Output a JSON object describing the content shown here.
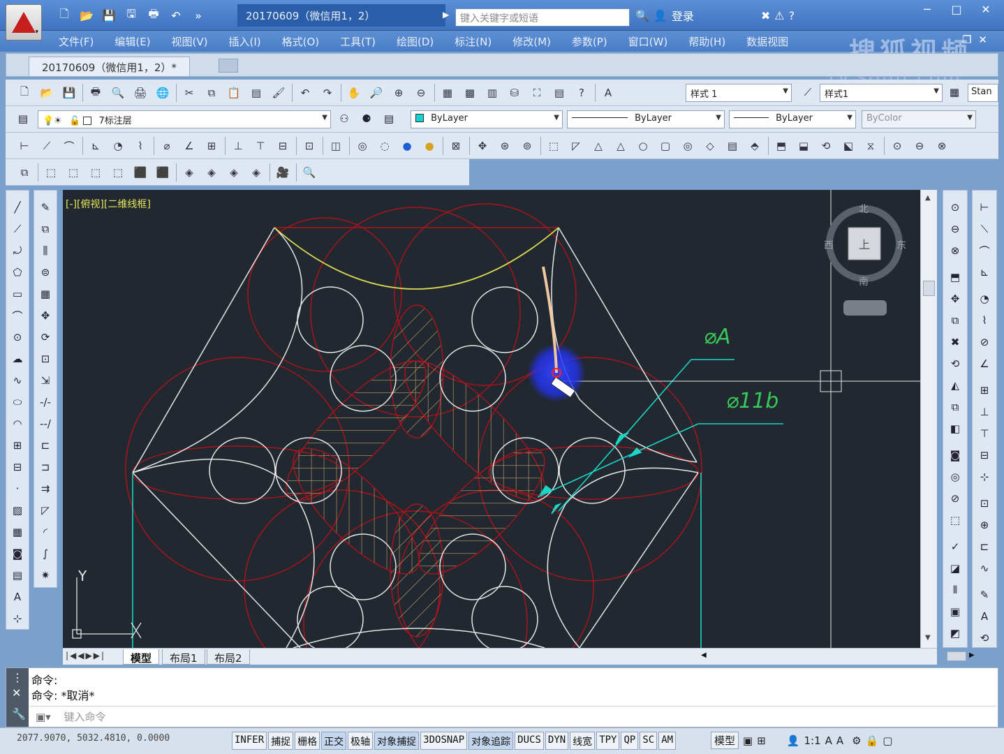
{
  "app": {
    "document_title": "20170609（微信用1，2）",
    "search_placeholder": "键入关键字或短语",
    "login_label": "登录"
  },
  "window_buttons": [
    "─",
    "□",
    "✕"
  ],
  "menu": [
    "文件(F)",
    "编辑(E)",
    "视图(V)",
    "插入(I)",
    "格式(O)",
    "工具(T)",
    "绘图(D)",
    "标注(N)",
    "修改(M)",
    "参数(P)",
    "窗口(W)",
    "帮助(H)",
    "数据视图"
  ],
  "watermark": {
    "main": "搜狐视频",
    "sub": "tv.sohu.com"
  },
  "doc_tab": {
    "label": "20170609（微信用1，2）*"
  },
  "toolbar": {
    "text_style": "样式 1",
    "dim_style": "样式1",
    "table_style": "Stan",
    "layer": "7标注层",
    "color": "ByLayer",
    "linetype": "ByLayer",
    "lineweight": "ByLayer",
    "plotstyle": "ByColor"
  },
  "viewport": {
    "label": "[-][俯视][二维线框]",
    "dim_a": "⌀A",
    "dim_b": "⌀11b",
    "axis_y": "Y",
    "compass": {
      "n": "北",
      "s": "南",
      "w": "西",
      "e": "东",
      "top": "上"
    }
  },
  "layout_tabs": [
    {
      "label": "模型",
      "active": true
    },
    {
      "label": "布局1",
      "active": false
    },
    {
      "label": "布局2",
      "active": false
    }
  ],
  "command": {
    "line1": "命令:",
    "line2": "命令:  *取消*",
    "input_placeholder": "键入命令"
  },
  "status": {
    "coords": "2077.9070,  5032.4810,  0.0000",
    "buttons": [
      {
        "label": "INFER",
        "on": false
      },
      {
        "label": "捕捉",
        "on": false
      },
      {
        "label": "栅格",
        "on": false
      },
      {
        "label": "正交",
        "on": true
      },
      {
        "label": "极轴",
        "on": false
      },
      {
        "label": "对象捕捉",
        "on": true
      },
      {
        "label": "3DOSNAP",
        "on": false
      },
      {
        "label": "对象追踪",
        "on": true
      },
      {
        "label": "DUCS",
        "on": false
      },
      {
        "label": "DYN",
        "on": false
      },
      {
        "label": "线宽",
        "on": false
      },
      {
        "label": "TPY",
        "on": false
      },
      {
        "label": "QP",
        "on": false
      },
      {
        "label": "SC",
        "on": false
      },
      {
        "label": "AM",
        "on": false
      }
    ],
    "model_label": "模型",
    "scale": "1:1"
  },
  "colors": {
    "canvas": "#212830",
    "white_lines": "#e6e6e6",
    "red_lines": "#b0121b",
    "yellow_line": "#dcdc52",
    "hatch": "#c8a46a",
    "cyan_dims": "#19d6c6",
    "green_text": "#39c85a",
    "cursor_highlight": "#2233ee"
  }
}
